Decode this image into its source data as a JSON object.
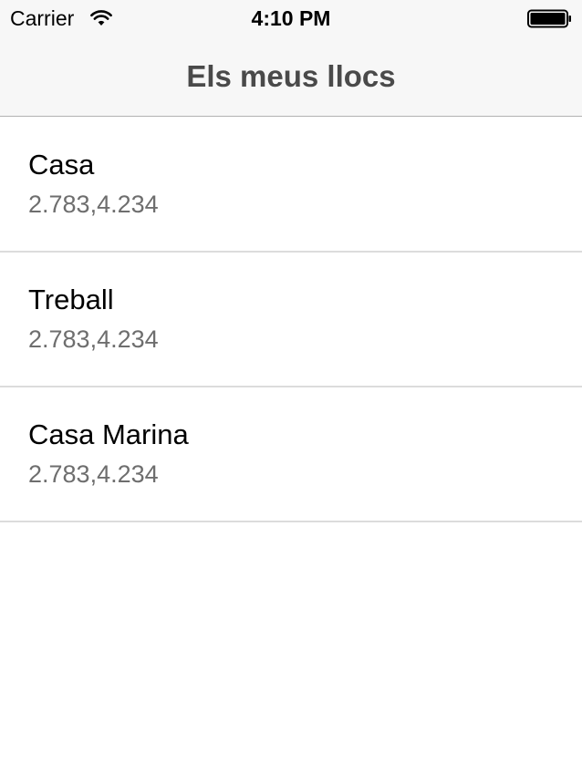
{
  "status_bar": {
    "carrier": "Carrier",
    "time": "4:10 PM",
    "wifi_icon": "wifi-icon",
    "battery_icon": "battery-icon"
  },
  "nav": {
    "title": "Els meus llocs"
  },
  "places": [
    {
      "name": "Casa",
      "coords": "2.783,4.234"
    },
    {
      "name": "Treball",
      "coords": "2.783,4.234"
    },
    {
      "name": "Casa Marina",
      "coords": "2.783,4.234"
    }
  ],
  "colors": {
    "header_bg": "#f7f7f7",
    "title_text": "#4a4a4a",
    "subtitle_text": "#6e6e6e",
    "separator": "#dcdcdc"
  }
}
